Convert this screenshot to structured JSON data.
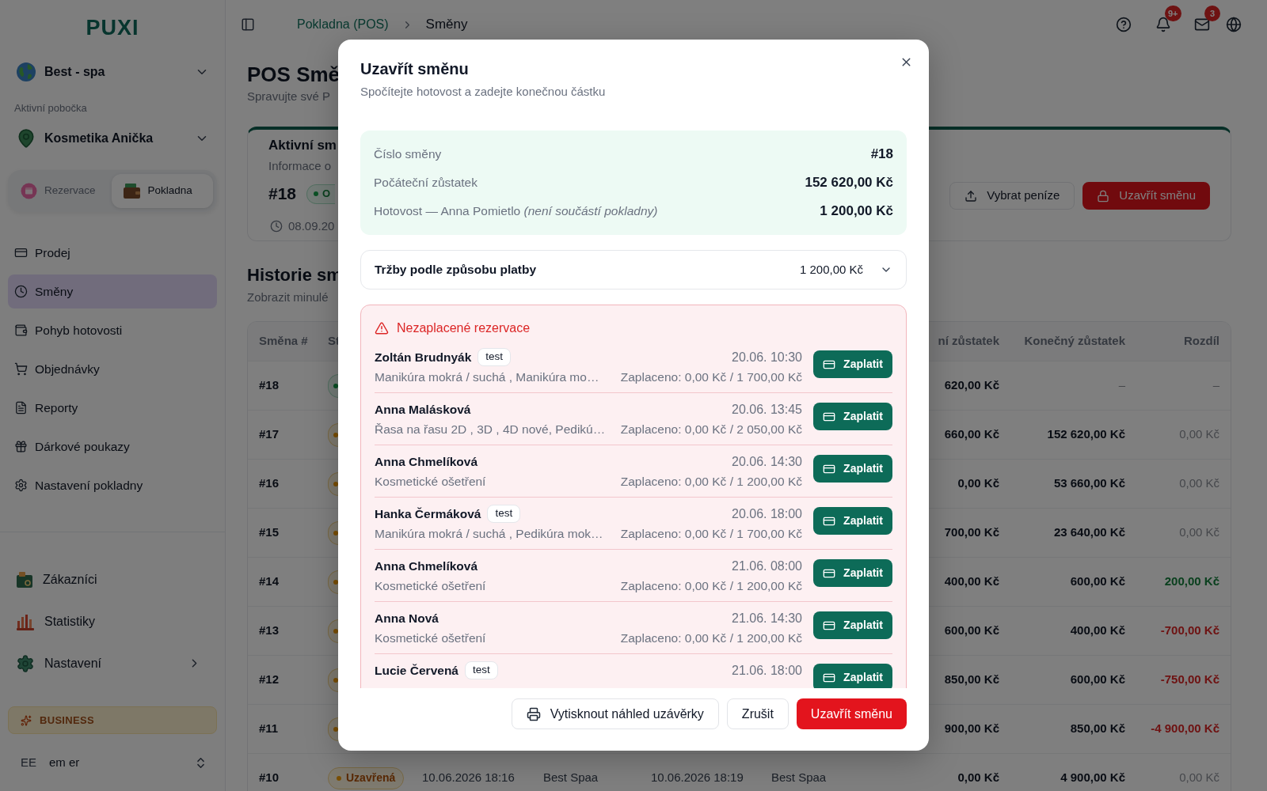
{
  "sidebar": {
    "logo": "PUXI",
    "workspace": "Best - spa",
    "branch_label": "Aktivní pobočka",
    "branch": "Kosmetika Anička",
    "mode_tabs": [
      {
        "label": "Rezervace",
        "selected": false
      },
      {
        "label": "Pokladna",
        "selected": true
      }
    ],
    "nav_items": [
      {
        "label": "Prodej",
        "selected": false
      },
      {
        "label": "Směny",
        "selected": true
      },
      {
        "label": "Pohyb hotovosti",
        "selected": false
      },
      {
        "label": "Objednávky",
        "selected": false
      },
      {
        "label": "Reporty",
        "selected": false
      },
      {
        "label": "Dárkové poukazy",
        "selected": false
      },
      {
        "label": "Nastavení pokladny",
        "selected": false
      }
    ],
    "secondary_items": [
      {
        "label": "Zákazníci",
        "has_submenu": false
      },
      {
        "label": "Statistiky",
        "has_submenu": false
      },
      {
        "label": "Nastavení",
        "has_submenu": true
      }
    ],
    "plan_badge": "BUSINESS",
    "user": {
      "initials": "EE",
      "name": "em er"
    }
  },
  "header": {
    "breadcrumb": [
      {
        "label": "Pokladna (POS)",
        "current": false
      },
      {
        "label": "Směny",
        "current": true
      }
    ],
    "notifications_count": "9+",
    "messages_count": "3"
  },
  "page": {
    "title": "POS Smě",
    "subtitle": "Spravujte své P",
    "active_shift": {
      "title": "Aktivní sm",
      "subtitle": "Informace o",
      "number": "#18",
      "open": true,
      "status_label": "O",
      "opened": "08.09.20",
      "actions": [
        {
          "label": "Vybrat peníze",
          "kind": "withdraw"
        },
        {
          "label": "Uzavřít směnu",
          "kind": "close"
        }
      ]
    },
    "history": {
      "title": "Historie sm",
      "subtitle": "Zobrazit minulé",
      "columns": {
        "shift": "Směna #",
        "column_2": "St",
        "column_7": "ní zůstatek",
        "closing_balance": "Konečný zůstatek",
        "difference": "Rozdíl"
      },
      "rows": [
        {
          "shift": "#18",
          "open": true,
          "column_7": "620,00 Kč",
          "closing_balance": {
            "text": "–",
            "muted": true
          },
          "difference": {
            "text": "–",
            "kind": "neutral"
          }
        },
        {
          "shift": "#17",
          "open": false,
          "column_7": "660,00 Kč",
          "closing_balance": {
            "text": "152 620,00 Kč",
            "muted": false
          },
          "difference": {
            "text": "0,00 Kč",
            "kind": "neutral"
          }
        },
        {
          "shift": "#16",
          "open": false,
          "column_7": "0,00 Kč",
          "closing_balance": {
            "text": "53 660,00 Kč",
            "muted": false
          },
          "difference": {
            "text": "0,00 Kč",
            "kind": "neutral"
          }
        },
        {
          "shift": "#15",
          "open": false,
          "column_7": "700,00 Kč",
          "closing_balance": {
            "text": "23 640,00 Kč",
            "muted": false
          },
          "difference": {
            "text": "0,00 Kč",
            "kind": "neutral"
          }
        },
        {
          "shift": "#14",
          "open": false,
          "column_7": "400,00 Kč",
          "closing_balance": {
            "text": "600,00 Kč",
            "muted": false
          },
          "difference": {
            "text": "200,00 Kč",
            "kind": "gain"
          }
        },
        {
          "shift": "#13",
          "open": false,
          "column_7": "600,00 Kč",
          "closing_balance": {
            "text": "400,00 Kč",
            "muted": false
          },
          "difference": {
            "text": "-700,00 Kč",
            "kind": "loss"
          }
        },
        {
          "shift": "#12",
          "open": false,
          "column_7": "850,00 Kč",
          "closing_balance": {
            "text": "600,00 Kč",
            "muted": false
          },
          "difference": {
            "text": "-750,00 Kč",
            "kind": "loss"
          }
        },
        {
          "shift": "#11",
          "open": false,
          "column_7": "900,00 Kč",
          "closing_balance": {
            "text": "850,00 Kč",
            "muted": false
          },
          "difference": {
            "text": "-4 900,00 Kč",
            "kind": "loss"
          }
        },
        {
          "shift": "#10",
          "open": false,
          "status_label": "Uzavřená",
          "column_3": "10.06.2026 18:16",
          "column_4": "Best Spaa",
          "column_5": "10.06.2026 18:19",
          "column_6": "Best Spaa",
          "column_7": "0,00 Kč",
          "closing_balance": {
            "text": "4 900,00 Kč",
            "muted": false
          },
          "difference": {
            "text": "0,00 Kč",
            "kind": "neutral"
          }
        }
      ]
    }
  },
  "modal": {
    "title": "Uzavřít směnu",
    "subtitle": "Spočítejte hotovost a zadejte konečnou částku",
    "summary": [
      {
        "label": "Číslo směny",
        "value": "#18"
      },
      {
        "label": "Počáteční zůstatek",
        "value": "152 620,00 Kč"
      },
      {
        "label": "Hotovost — Anna Pomietlo *(není součástí pokladny)*",
        "value": "1 200,00 Kč"
      }
    ],
    "payment_breakdown": {
      "label": "Tržby podle způsobu platby",
      "value": "1 200,00 Kč",
      "expanded": false
    },
    "unpaid": {
      "title": "Nezaplacené rezervace",
      "items": [
        {
          "name": "Zoltán Brudnyák",
          "tag": "test",
          "time": "20.06. 10:30",
          "services": "Manikúra mokrá / suchá , Manikúra mo…",
          "paid": "Zaplaceno: 0,00 Kč / 1 700,00 Kč",
          "action": "Zaplatit"
        },
        {
          "name": "Anna Malásková",
          "time": "20.06. 13:45",
          "services": "Řasa na řasu 2D , 3D , 4D nové, Pedikú…",
          "paid": "Zaplaceno: 0,00 Kč / 2 050,00 Kč",
          "action": "Zaplatit"
        },
        {
          "name": "Anna Chmelíková",
          "time": "20.06. 14:30",
          "services": "Kosmetické ošetření",
          "paid": "Zaplaceno: 0,00 Kč / 1 200,00 Kč",
          "action": "Zaplatit"
        },
        {
          "name": "Hanka Čermáková",
          "tag": "test",
          "time": "20.06. 18:00",
          "services": "Manikúra mokrá / suchá , Pedikúra mok…",
          "paid": "Zaplaceno: 0,00 Kč / 1 700,00 Kč",
          "action": "Zaplatit"
        },
        {
          "name": "Anna Chmelíková",
          "time": "21.06. 08:00",
          "services": "Kosmetické ošetření",
          "paid": "Zaplaceno: 0,00 Kč / 1 200,00 Kč",
          "action": "Zaplatit"
        },
        {
          "name": "Anna Nová",
          "time": "21.06. 14:30",
          "services": "Kosmetické ošetření",
          "paid": "Zaplaceno: 0,00 Kč / 1 200,00 Kč",
          "action": "Zaplatit"
        },
        {
          "name": "Lucie Červená",
          "tag": "test",
          "time": "21.06. 18:00",
          "action": "Zaplatit"
        }
      ]
    },
    "footer_buttons": [
      {
        "label": "Vytisknout náhled uzávěrky",
        "kind": "print"
      },
      {
        "label": "Zrušit",
        "kind": "cancel"
      },
      {
        "label": "Uzavřít směnu",
        "kind": "confirm"
      }
    ]
  }
}
